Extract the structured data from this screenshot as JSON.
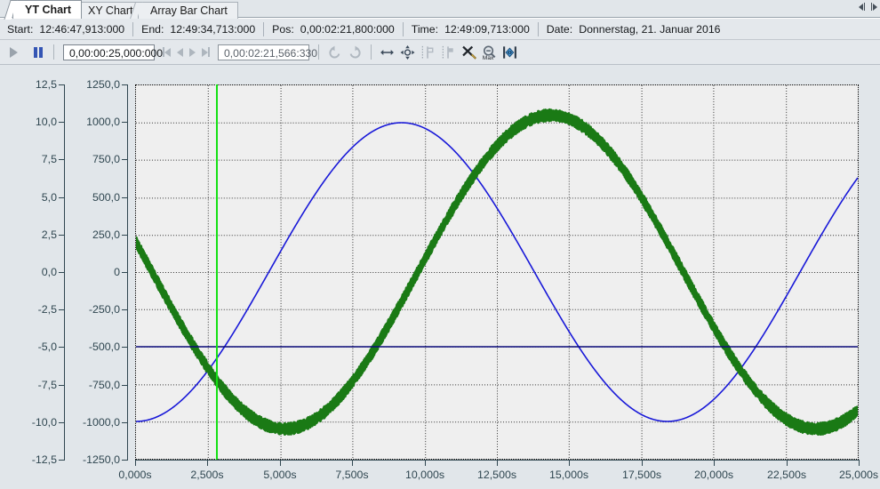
{
  "tabs": [
    {
      "label": "YT Chart",
      "active": true
    },
    {
      "label": "XY Chart",
      "active": false
    },
    {
      "label": "Array Bar Chart",
      "active": false
    }
  ],
  "tab_scrollers": {
    "prev_icon": "scroll-left-icon",
    "next_icon": "scroll-right-icon"
  },
  "infobar": {
    "start_label": "Start:",
    "start_value": "12:46:47,913:000",
    "end_label": "End:",
    "end_value": "12:49:34,713:000",
    "pos_label": "Pos:",
    "pos_value": "0,00:02:21,800:000",
    "time_label": "Time:",
    "time_value": "12:49:09,713:000",
    "date_label": "Date:",
    "date_value": "Donnerstag, 21. Januar 2016"
  },
  "toolbar": {
    "play_icon": "play-icon",
    "pause_icon": "pause-icon",
    "range_value": "0,00:00:25,000:000",
    "first_icon": "skip-to-first-icon",
    "prev_icon": "step-back-icon",
    "next_icon": "step-forward-icon",
    "last_icon": "skip-to-last-icon",
    "position_value": "0,00:02:21,566:330",
    "undo_zoom_icon": "undo-rotate-ccw-icon",
    "redo_zoom_icon": "redo-rotate-cw-icon",
    "zoom_horizontal_icon": "zoom-horizontal-icon",
    "pan_icon": "pan-move-icon",
    "cursor1_icon": "cursor-marker-1-icon",
    "cursor2_icon": "cursor-marker-2-icon",
    "clear_markers_icon": "clear-markers-icon",
    "zoom_max_icon": "zoom-max-icon",
    "fit_width_icon": "fit-to-width-icon"
  },
  "chart_data": {
    "type": "line",
    "title": "",
    "xlabel": "",
    "grid": true,
    "legend": null,
    "plot_background": "#efefef",
    "x": {
      "min": 0,
      "max": 25,
      "unit": "s",
      "tick_step": 2.5,
      "ticks": [
        "0,000s",
        "2,500s",
        "5,000s",
        "7,500s",
        "10,000s",
        "12,500s",
        "15,000s",
        "17,500s",
        "20,000s",
        "22,500s",
        "25,000s"
      ]
    },
    "axes": [
      {
        "name": "axis-left-1",
        "min": -12.5,
        "max": 12.5,
        "tick_step": 2.5,
        "ticks": [
          "12,5",
          "10,0",
          "7,5",
          "5,0",
          "2,5",
          "0,0",
          "-2,5",
          "-5,0",
          "-7,5",
          "-10,0",
          "-12,5"
        ],
        "color": "#2f4650"
      },
      {
        "name": "axis-left-2",
        "min": -1250,
        "max": 1250,
        "tick_step": 250,
        "ticks": [
          "1250,0",
          "1000,0",
          "750,0",
          "500,0",
          "250,0",
          "0",
          "-250,0",
          "-500,0",
          "-750,0",
          "-1000,0",
          "-1250,0"
        ],
        "color": "#2f4650"
      }
    ],
    "cursor": {
      "name": "time-cursor",
      "x": 2.8,
      "color": "#14e014"
    },
    "series": [
      {
        "name": "blue-sine",
        "color": "#1818d8",
        "axis": "axis-left-2",
        "type": "line",
        "width": 1.6,
        "noise": 0,
        "description": "clean sine wave, amplitude 1000, period ~18,4s, starts at -1000 (minimum) at 0s, peaks +1000 near 9,3s, minimum near 18,5s, rising to ~620 at 25s",
        "amplitude": 1000,
        "period": 18.4,
        "phase_at_zero": -1000,
        "offset": 0
      },
      {
        "name": "green-noisy-sine",
        "color": "#1a7a15",
        "axis": "axis-left-2",
        "type": "line",
        "width": 4,
        "noise": 40,
        "description": "noisy sine wave, amplitude ~1050, period ~18,4s, starts at ~200 at 0s falling to minimum ~-1080 near 5s, peaks ~+1060 near 14s, minimum near 23s, rising to ~-760 at 25s",
        "amplitude": 1050,
        "period": 18.4,
        "phase_at_zero": 200,
        "offset": 0
      },
      {
        "name": "navy-constant-line",
        "color": "#0a0a78",
        "axis": "axis-left-2",
        "type": "line",
        "width": 1.4,
        "noise": 0,
        "description": "horizontal constant line at -500 (= -5,0 on axis 1)",
        "constant": -500
      }
    ]
  }
}
